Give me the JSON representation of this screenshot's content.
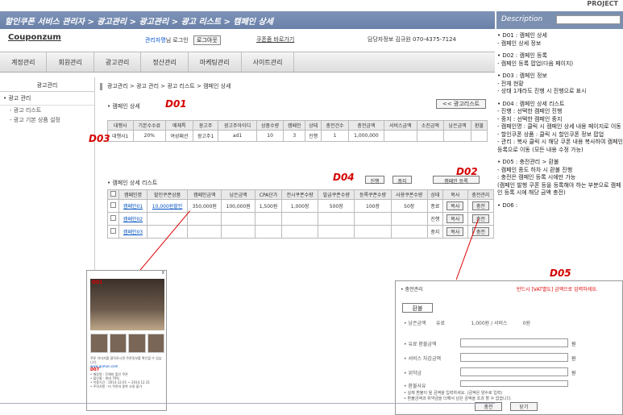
{
  "project_label": "PROJECT",
  "header_title": "할인쿠폰 서비스 관리자 > 광고관리 > 광고관리 > 광고 리스트 > 캠페인 상세",
  "desc_title": "Description",
  "logo": "Couponzum",
  "admin": {
    "name": "관리자명",
    "text": "님 로그인",
    "logout": "로그아웃"
  },
  "coupon_link": "쿠폰줌 바로가기",
  "contact": "담당자정보 김규원  070-4375-7124",
  "gnb": [
    "계정관리",
    "회원관리",
    "광고관리",
    "정산관리",
    "마케팅관리",
    "사이트관리"
  ],
  "lnb": {
    "title": "광고관리",
    "item": "• 광고 관리",
    "subs": [
      "- 광고 리스트",
      "- 광고 기본 상품 설정"
    ]
  },
  "breadcrumb": "광고관리 > 광고 관리 > 광고 리스트 > 캠페인 상세",
  "sec1_title": "• 캠페인 상세",
  "back_btn": "<< 광고리스트",
  "tags": {
    "d01": "D01",
    "d02": "D02",
    "d03": "D03",
    "d04": "D04",
    "d05": "D05"
  },
  "table1": {
    "headers": [
      "대행사",
      "기본수수료",
      "매체특",
      "광고주",
      "광고주아이디",
      "상품수량",
      "캠페인",
      "상태",
      "충전건수",
      "충전금액",
      "서비스금액",
      "소진금액",
      "남은금액",
      "환불"
    ],
    "row": [
      "대행사1",
      "20%",
      "여성패션",
      "광고주1",
      "ad1",
      "10",
      "3",
      "진행",
      "1",
      "1,000,000",
      "",
      "",
      "",
      ""
    ]
  },
  "sec2_title": "• 캠페인 상세 리스트",
  "buttons": {
    "progress": "진행",
    "stop": "중지",
    "register": "캠페인 등록"
  },
  "table2": {
    "headers": [
      "",
      "캠페인명",
      "할인쿠폰상품",
      "캠페인금액",
      "남은금액",
      "CPA단가",
      "전시쿠폰수량",
      "발급쿠폰수량",
      "등록쿠폰수량",
      "사용쿠폰수량",
      "상태",
      "복사",
      "충전관리"
    ],
    "rows": [
      [
        "",
        "캠페인01",
        "10,000원할인",
        "350,000원",
        "100,000원",
        "1,500원",
        "1,000장",
        "500장",
        "100장",
        "50장",
        "종료",
        "복사",
        "충전"
      ],
      [
        "",
        "캠페인02",
        "",
        "",
        "",
        "",
        "",
        "",
        "",
        "",
        "진행",
        "복사",
        "충전"
      ],
      [
        "",
        "캠페인03",
        "",
        "",
        "",
        "",
        "",
        "",
        "",
        "",
        "중지",
        "복사",
        "충전"
      ]
    ]
  },
  "desc": [
    "• D01 : 캠페인 상세\n - 캠페인 상세 정보",
    "• D02 : 캠페인 등록\n - 캠페인 등록 팝업(다음 페이지)",
    "• D03 : 캠페인 정보\n - 전체 현황\n - 상태 1개라도 진행 시 진행으로 표시",
    "• D04 : 캠페인 상세 리스트\n - 진행 : 선택한 캠페인 진행\n - 중지 : 선택한 캠페인 중지\n - 캠페인명 : 클릭 시 캠페인 상세 내용 페이지로 이동\n - 할인쿠폰 상품 : 클릭 시 할인쿠폰 정보 팝업\n - 관리 : 복사 클릭 시 해당 쿠폰 내용 복사하여 캠페인 등록으로 이동 (모든 내용 수정 가능)",
    "• D05 : 충전관리 > 환불\n - 캠페인 종도 하차 시 환불 진행\n  : 충전은 캠페인 등록 시에만 가능\n  (캠페인 발행 쿠폰 등을 등록해야 하는 부분으로 캠페인 등록 시에 해당 금액 충전)",
    "• D06 :"
  ],
  "popup1": {
    "close": "X",
    "tag": "D01",
    "site": "www.gumon.com",
    "tag2": "D07",
    "lines": [
      "쿠폰 이미지를 클릭하시면 쿠폰정보를 확인할 수 있습니다.",
      "• 매장명 : 진해피 할인 쿠폰",
      "• 할인율 : 최대 70%",
      "• 이용기간 : 2014.12.01 ~ 2014.12.31",
      "• 주의사항 : 타 쿠폰과 중복 사용 불가"
    ]
  },
  "popup2": {
    "title": "• 충전관리",
    "warn": "반드시 [VAT별도] 금액으로 입력하세요.",
    "refund": "환불",
    "balance_label": "• 남은금액",
    "balance": "유료                 1,000원 / 서비스          0원",
    "fields": [
      "• 유료 환불금액",
      "• 서비스 차감금액",
      "• 위약금",
      "• 환불사유"
    ],
    "unit": "원",
    "note": "• 실제 환불이 될 금액을 입력하세요. (금액은 양수로 입력)\n• 환불금액과 위약금을 더해서 남은 금액을 초과 할 수 없습니다.",
    "ok": "충전",
    "cancel": "닫기"
  }
}
